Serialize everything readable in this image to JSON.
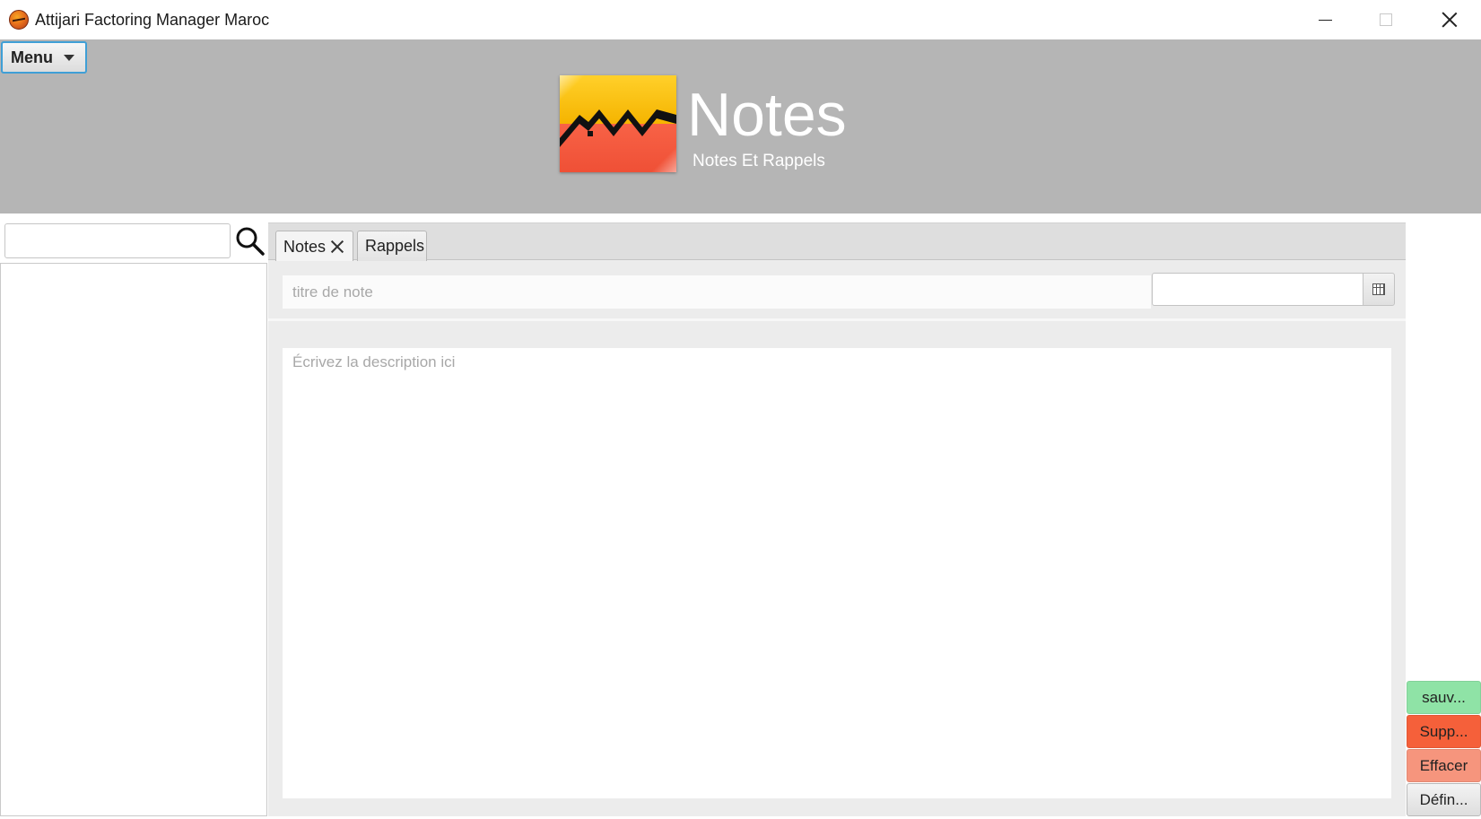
{
  "window": {
    "title": "Attijari Factoring Manager Maroc",
    "icon": "app-logo-icon"
  },
  "header": {
    "menu_label": "Menu",
    "page_title": "Notes",
    "page_subtitle": "Notes Et Rappels",
    "colors": {
      "band": "#b5b5b5",
      "logo_top": "#f5b400",
      "logo_bottom": "#ef5036"
    }
  },
  "search": {
    "value": "",
    "placeholder": ""
  },
  "tabs": [
    {
      "label": "Notes",
      "active": true,
      "closable": true
    },
    {
      "label": "Rappels",
      "active": false,
      "closable": false
    }
  ],
  "note_form": {
    "title_placeholder": "titre de note",
    "title_value": "",
    "date_value": "",
    "description_placeholder": "Écrivez la description ici",
    "description_value": ""
  },
  "actions": {
    "save_label": "sauv...",
    "delete_label": "Supp...",
    "clear_label": "Effacer",
    "define_label": "Défin...",
    "colors": {
      "save": "#8fe3a6",
      "delete": "#f5603a",
      "clear": "#f6957d"
    }
  }
}
